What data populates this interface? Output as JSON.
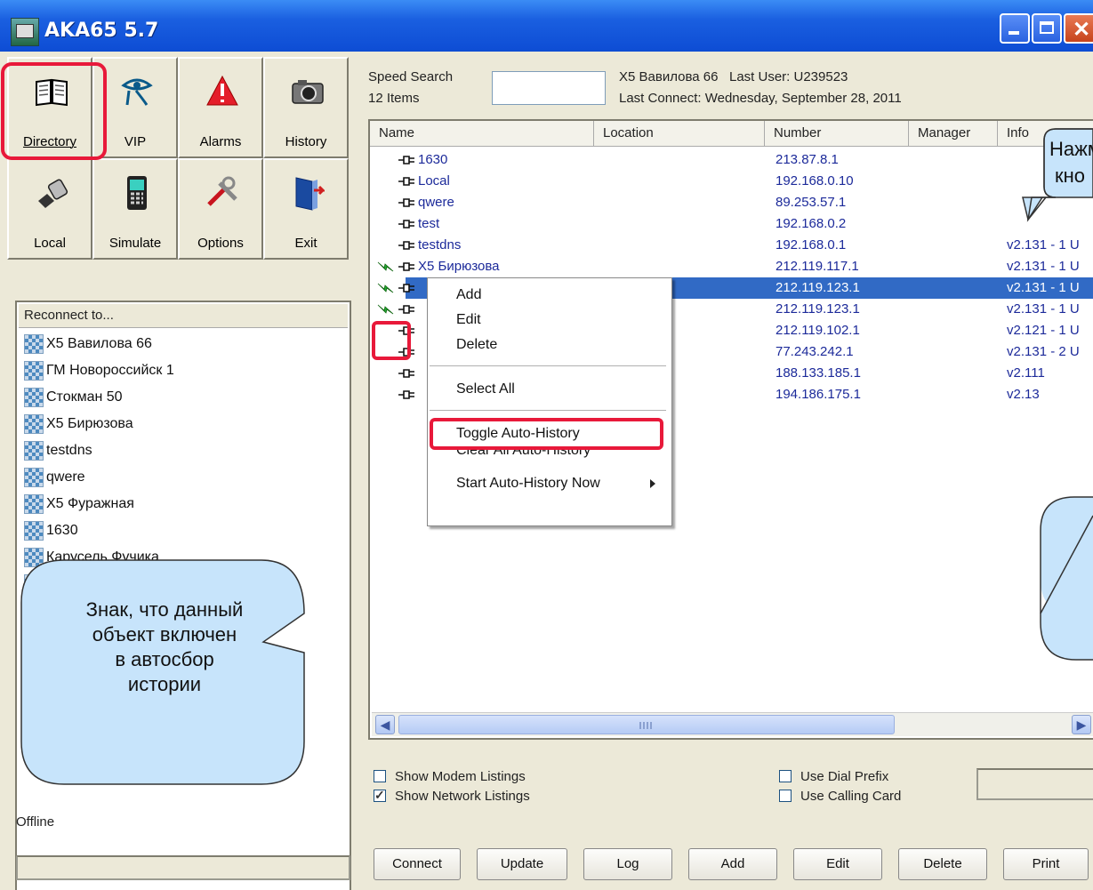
{
  "window": {
    "title": "AKA65 5.7"
  },
  "toolbar": {
    "directory": "Directory",
    "vip": "VIP",
    "alarms": "Alarms",
    "history": "History",
    "local": "Local",
    "simulate": "Simulate",
    "options": "Options",
    "exit": "Exit"
  },
  "left": {
    "header": "Reconnect to...",
    "items": [
      "Х5 Вавилова 66",
      "ГМ Новороссийск 1",
      "Стокман 50",
      "Х5 Бирюзова",
      "testdns",
      "qwere",
      "Х5 Фуражная",
      "1630",
      "Карусель Фучика",
      "Local"
    ],
    "status": "Offline"
  },
  "search": {
    "label": "Speed Search",
    "count": "12 Items",
    "value": ""
  },
  "last": {
    "site": "Х5 Вавилова 66",
    "user": "Last User: U239523",
    "connect": "Last Connect: Wednesday, September 28, 2011"
  },
  "columns": [
    "Name",
    "Location",
    "Number",
    "Manager",
    "Info"
  ],
  "rows": [
    {
      "name": "1630",
      "number": "213.87.8.1",
      "info": ""
    },
    {
      "name": "Local",
      "number": "192.168.0.10",
      "info": ""
    },
    {
      "name": "qwere",
      "number": "89.253.57.1",
      "info": ""
    },
    {
      "name": "test",
      "number": "192.168.0.2",
      "info": ""
    },
    {
      "name": "testdns",
      "number": "192.168.0.1",
      "info": "v2.131 - 1 U"
    },
    {
      "name": "Х5 Бирюзова",
      "number": "212.119.117.1",
      "info": "v2.131 - 1 U"
    },
    {
      "name": "",
      "number": "212.119.123.1",
      "info": "v2.131 - 1 U"
    },
    {
      "name": "",
      "number": "212.119.123.1",
      "info": "v2.131 - 1 U"
    },
    {
      "name": "",
      "number": "212.119.102.1",
      "info": "v2.121 - 1 U"
    },
    {
      "name": "",
      "number": "77.243.242.1",
      "info": "v2.131 - 2 U"
    },
    {
      "name": "",
      "number": "188.133.185.1",
      "info": "v2.111"
    },
    {
      "name": "",
      "number": "194.186.175.1",
      "info": "v2.13"
    }
  ],
  "context_menu": {
    "add": "Add",
    "edit": "Edit",
    "delete": "Delete",
    "select_all": "Select All",
    "toggle": "Toggle Auto-History",
    "clear": "Clear All Auto-History",
    "start": "Start Auto-History Now"
  },
  "checkboxes": {
    "modem": {
      "label": "Show Modem Listings",
      "checked": false
    },
    "network": {
      "label": "Show Network Listings",
      "checked": true
    },
    "dial": {
      "label": "Use Dial Prefix",
      "checked": false
    },
    "card": {
      "label": "Use Calling Card",
      "checked": false
    }
  },
  "buttons": {
    "connect": "Connect",
    "update": "Update",
    "log": "Log",
    "add": "Add",
    "edit": "Edit",
    "delete": "Delete",
    "print": "Print"
  },
  "callouts": {
    "top_right_1": "Нажм",
    "top_right_2": "кно",
    "left": [
      "Знак, что данный",
      "объект включен",
      "в автосбор",
      "истории"
    ]
  },
  "colors": {
    "highlight": "#e8193a",
    "callout_fill": "#c7e4fb",
    "selection": "#316ac5",
    "link_text": "#1c2a9a"
  }
}
